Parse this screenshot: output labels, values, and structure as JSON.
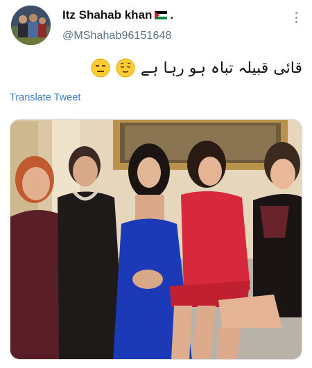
{
  "user": {
    "display_name": "Itz Shahab khan",
    "handle": "@MShahab96151648",
    "flag_icon": "palestine-flag-icon"
  },
  "tweet": {
    "text": "قائی قبیلہ تباہ ہو رہا ہے",
    "emojis": [
      "relieved-face-emoji",
      "expressionless-face-emoji"
    ],
    "translate_label": "Translate Tweet"
  },
  "media": {
    "description_icon": "group-photo-image"
  },
  "colors": {
    "link": "#3b7bbf",
    "handle": "#5b7083",
    "text": "#0f1419"
  }
}
